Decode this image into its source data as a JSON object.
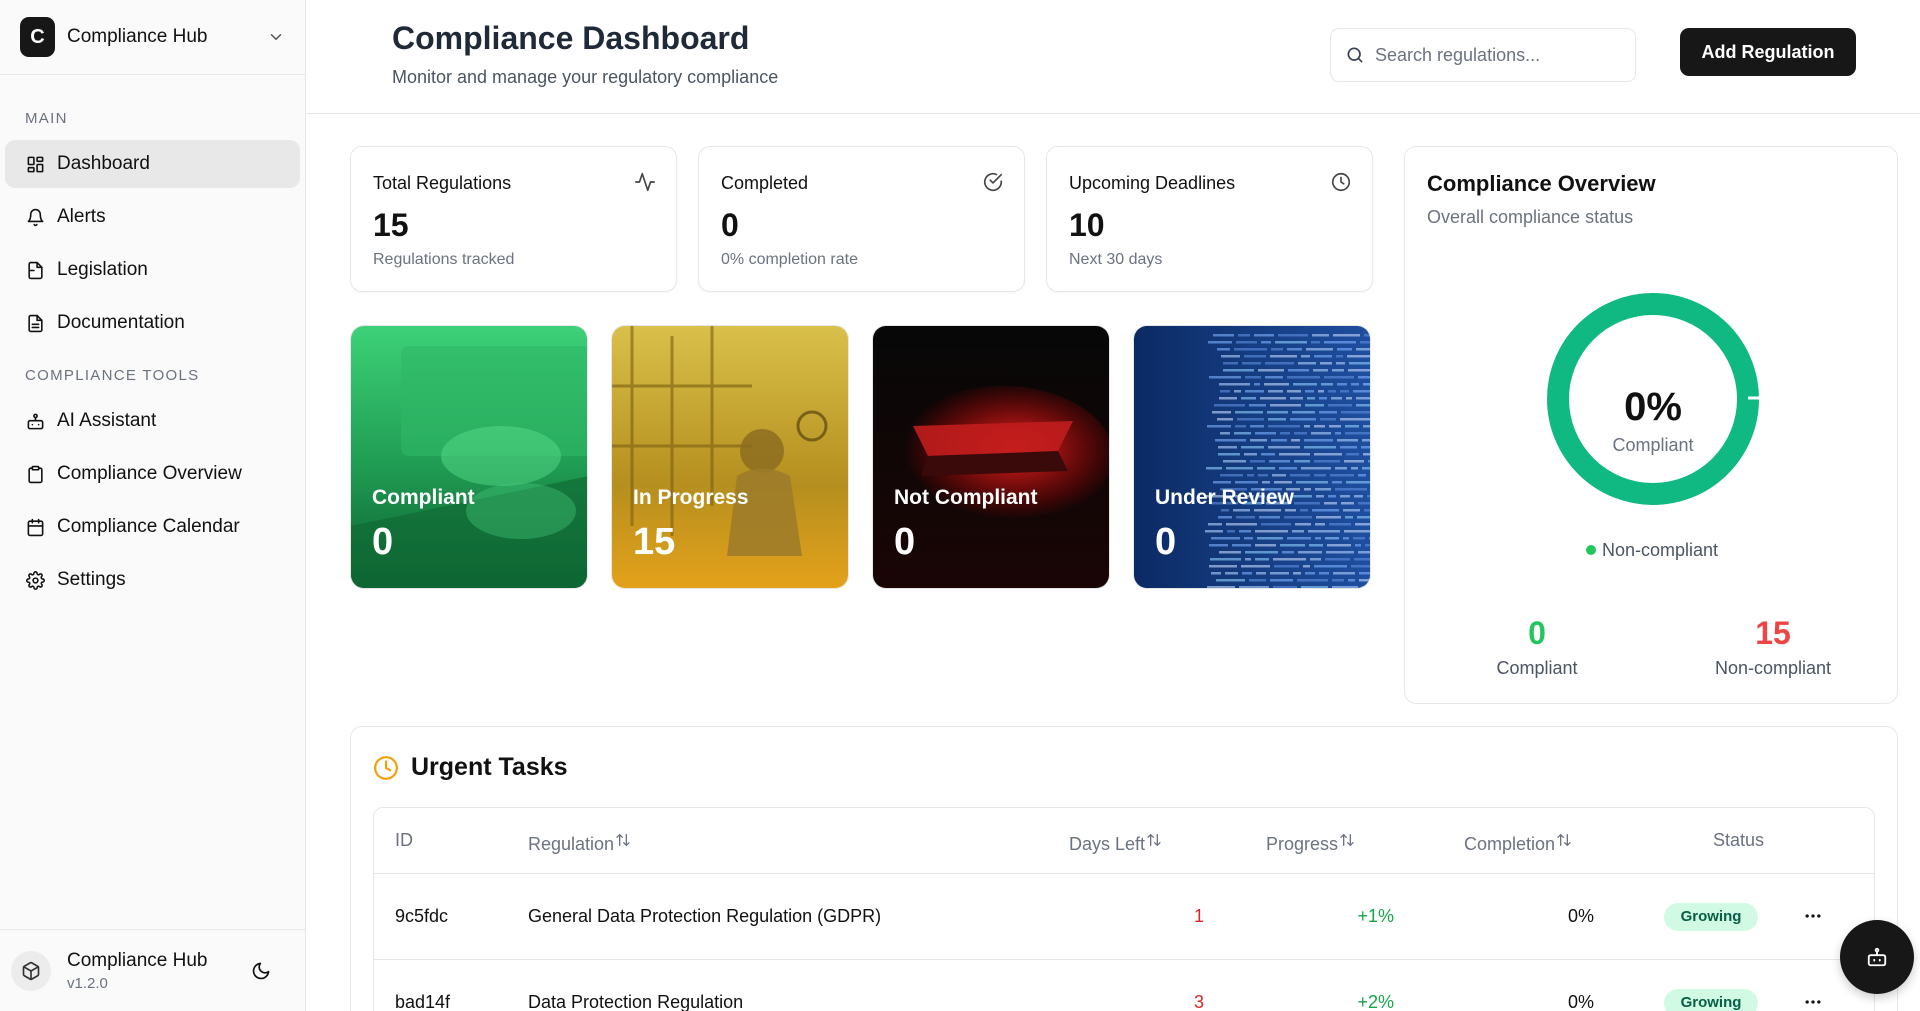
{
  "app": {
    "brand_initial": "C",
    "brand_name": "Compliance Hub"
  },
  "sidebar": {
    "sections": [
      {
        "heading": "MAIN",
        "items": [
          {
            "label": "Dashboard",
            "icon": "grid-icon",
            "active": true
          },
          {
            "label": "Alerts",
            "icon": "bell-icon"
          },
          {
            "label": "Legislation",
            "icon": "file-icon"
          },
          {
            "label": "Documentation",
            "icon": "document-icon"
          }
        ]
      },
      {
        "heading": "COMPLIANCE TOOLS",
        "items": [
          {
            "label": "AI Assistant",
            "icon": "bot-icon"
          },
          {
            "label": "Compliance Overview",
            "icon": "clipboard-icon"
          },
          {
            "label": "Compliance Calendar",
            "icon": "calendar-icon"
          },
          {
            "label": "Settings",
            "icon": "gear-icon"
          }
        ]
      }
    ],
    "footer": {
      "name": "Compliance Hub",
      "version": "v1.2.0"
    }
  },
  "header": {
    "title": "Compliance Dashboard",
    "subtitle": "Monitor and manage your regulatory compliance",
    "search_placeholder": "Search regulations...",
    "add_button": "Add Regulation"
  },
  "stats": [
    {
      "label": "Total Regulations",
      "value": "15",
      "sub": "Regulations tracked",
      "icon": "activity-icon"
    },
    {
      "label": "Completed",
      "value": "0",
      "sub": "0% completion rate",
      "icon": "check-circle-icon"
    },
    {
      "label": "Upcoming Deadlines",
      "value": "10",
      "sub": "Next 30 days",
      "icon": "clock-icon"
    }
  ],
  "tiles": [
    {
      "label": "Compliant",
      "value": "0",
      "color": "#22c55e"
    },
    {
      "label": "In Progress",
      "value": "15",
      "color": "#eab308"
    },
    {
      "label": "Not Compliant",
      "value": "0",
      "color": "#ef4444"
    },
    {
      "label": "Under Review",
      "value": "0",
      "color": "#1e3a8a"
    }
  ],
  "overview": {
    "title": "Compliance Overview",
    "subtitle": "Overall compliance status",
    "percent": "0%",
    "percent_label": "Compliant",
    "compliant_fraction": 0,
    "legend": "Non-compliant",
    "ring_color": "#10b981",
    "compliant_count": "0",
    "compliant_label": "Compliant",
    "compliant_color": "#22c55e",
    "noncompliant_count": "15",
    "noncompliant_label": "Non-compliant",
    "noncompliant_color": "#ef4444"
  },
  "urgent": {
    "title": "Urgent Tasks",
    "columns": {
      "id": "ID",
      "regulation": "Regulation",
      "days_left": "Days Left",
      "progress": "Progress",
      "completion": "Completion",
      "status": "Status"
    },
    "rows": [
      {
        "id": "9c5fdc",
        "regulation": "General Data Protection Regulation (GDPR)",
        "days_left": "1",
        "progress": "+1%",
        "completion": "0%",
        "status": "Growing"
      },
      {
        "id": "bad14f",
        "regulation": "Data Protection Regulation",
        "days_left": "3",
        "progress": "+2%",
        "completion": "0%",
        "status": "Growing"
      }
    ]
  },
  "chat_button_icon": "bot-icon"
}
